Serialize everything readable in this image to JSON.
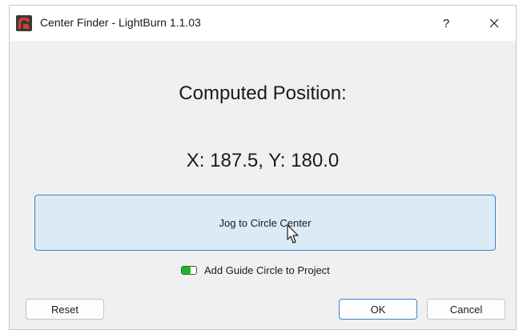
{
  "window": {
    "title": "Center Finder - LightBurn 1.1.03",
    "app_icon": "lightburn-logo-icon",
    "help_label": "?",
    "close_icon": "close-icon"
  },
  "main": {
    "heading": "Computed Position:",
    "position_text": "X: 187.5, Y: 180.0",
    "jog_button_label": "Jog to Circle Center",
    "guide_toggle": {
      "label": "Add Guide Circle to Project",
      "checked": true,
      "accent_color": "#27b02b"
    }
  },
  "footer": {
    "reset_label": "Reset",
    "ok_label": "OK",
    "cancel_label": "Cancel"
  },
  "colors": {
    "dialog_bg": "#f0f0f0",
    "focus_border": "#3c82d2",
    "jog_button_bg": "#dceaf6"
  }
}
